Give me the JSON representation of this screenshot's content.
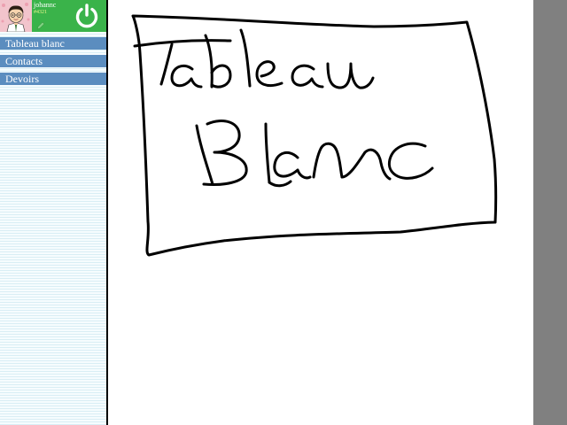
{
  "user": {
    "name": "johannc",
    "code": "#4321"
  },
  "nav": {
    "items": [
      {
        "label": "Tableau blanc"
      },
      {
        "label": "Contacts"
      },
      {
        "label": "Devoirs"
      }
    ]
  },
  "board": {
    "drawn_text": [
      "Tableau",
      "Blanc"
    ],
    "ink_color": "#000000"
  },
  "colors": {
    "header_green": "#3ab34a",
    "nav_blue": "#5b8dbf",
    "scroll_gray": "#808080",
    "avatar_bg": "#f2c4cc"
  },
  "icons": {
    "power": "power-icon",
    "edit": "pencil-icon"
  }
}
